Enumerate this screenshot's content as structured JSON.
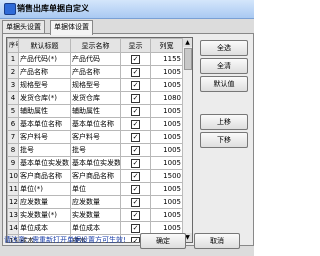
{
  "window": {
    "title": "销售出库单据自定义"
  },
  "tabs": [
    {
      "label": "单据头设置"
    },
    {
      "label": "单据体设置"
    }
  ],
  "grid": {
    "columns": {
      "index": "序号",
      "default_title": "默认标题",
      "display_name": "显示名称",
      "show": "显示",
      "width": "列宽"
    },
    "rows": [
      {
        "index": "1",
        "default_title": "产品代码(*)",
        "display_name": "产品代码",
        "show": true,
        "width": "1155"
      },
      {
        "index": "2",
        "default_title": "产品名称",
        "display_name": "产品名称",
        "show": true,
        "width": "1005"
      },
      {
        "index": "3",
        "default_title": "规格型号",
        "display_name": "规格型号",
        "show": true,
        "width": "1005"
      },
      {
        "index": "4",
        "default_title": "发货仓库(*)",
        "display_name": "发货仓库",
        "show": true,
        "width": "1080"
      },
      {
        "index": "5",
        "default_title": "辅助属性",
        "display_name": "辅助属性",
        "show": true,
        "width": "1005"
      },
      {
        "index": "6",
        "default_title": "基本单位名称",
        "display_name": "基本单位名称",
        "show": true,
        "width": "1005"
      },
      {
        "index": "7",
        "default_title": "客户料号",
        "display_name": "客户料号",
        "show": true,
        "width": "1005"
      },
      {
        "index": "8",
        "default_title": "批号",
        "display_name": "批号",
        "show": true,
        "width": "1005"
      },
      {
        "index": "9",
        "default_title": "基本单位实发数",
        "display_name": "基本单位实发数",
        "show": true,
        "width": "1005"
      },
      {
        "index": "10",
        "default_title": "客户商品名称",
        "display_name": "客户商品名称",
        "show": true,
        "width": "1500"
      },
      {
        "index": "11",
        "default_title": "单位(*)",
        "display_name": "单位",
        "show": true,
        "width": "1005"
      },
      {
        "index": "12",
        "default_title": "应发数量",
        "display_name": "应发数量",
        "show": true,
        "width": "1005"
      },
      {
        "index": "13",
        "default_title": "实发数量(*)",
        "display_name": "实发数量",
        "show": true,
        "width": "1005"
      },
      {
        "index": "14",
        "default_title": "单位成本",
        "display_name": "单位成本",
        "show": true,
        "width": "1005"
      },
      {
        "index": "15",
        "default_title": "成本",
        "display_name": "成本",
        "show": true,
        "width": "1005"
      }
    ]
  },
  "buttons": {
    "select_all": "全选",
    "clear_all": "全清",
    "default_value": "默认值",
    "move_up": "上移",
    "move_down": "下移",
    "ok": "确定",
    "cancel": "取消"
  },
  "hint": "请注意：需重新打开单据设置方可生效!",
  "colors": {
    "titlebar": "#a9c9f2",
    "hint_text": "#1a3ea8"
  },
  "icons": {
    "app": "app-icon",
    "checkbox_checked": "checkmark-icon"
  }
}
